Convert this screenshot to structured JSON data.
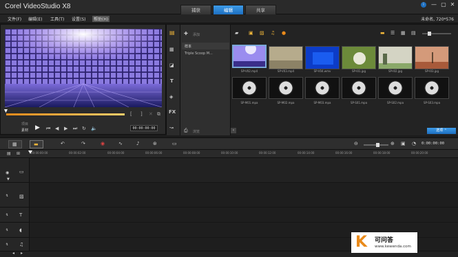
{
  "app": {
    "title": "Corel VideoStudio X8"
  },
  "tabs": [
    {
      "label": "捕获",
      "active": false
    },
    {
      "label": "编辑",
      "active": true
    },
    {
      "label": "共享",
      "active": false
    }
  ],
  "window_controls": {
    "info": "i",
    "minimize": "—",
    "restore": "▢",
    "close": "✕"
  },
  "menu": {
    "items": [
      {
        "label": "文件(F)"
      },
      {
        "label": "编辑(E)"
      },
      {
        "label": "工具(T)"
      },
      {
        "label": "设置(S)"
      },
      {
        "label": "帮助(H)",
        "active": true
      }
    ],
    "project_info": "未命名, 720*576"
  },
  "player": {
    "mode_project": "项目",
    "mode_clip": "素材",
    "timecode": "00:00:00:00"
  },
  "library": {
    "add_label": "添加",
    "browse_label": "浏览",
    "folders": [
      "样本",
      "Triple Scoop M..."
    ],
    "category_icons": [
      "media-icon",
      "instant-project-icon",
      "transition-icon",
      "title-icon",
      "graphic-icon",
      "filter-icon",
      "path-icon"
    ],
    "fx_label": "FX",
    "options_label": "选项",
    "thumbnails": [
      {
        "label": "SP-V02.mp4",
        "kind": "video",
        "selected": true
      },
      {
        "label": "SP-V03.mp4",
        "kind": "video"
      },
      {
        "label": "SP-V04.wmv",
        "kind": "video"
      },
      {
        "label": "SP-I01.jpg",
        "kind": "image"
      },
      {
        "label": "SP-I02.jpg",
        "kind": "image"
      },
      {
        "label": "SP-I03.jpg",
        "kind": "image"
      },
      {
        "label": "SP-M01.mpa",
        "kind": "audio"
      },
      {
        "label": "SP-M02.mpa",
        "kind": "audio"
      },
      {
        "label": "SP-M03.mpa",
        "kind": "audio"
      },
      {
        "label": "SP-S01.mpa",
        "kind": "audio"
      },
      {
        "label": "SP-S02.mpa",
        "kind": "audio"
      },
      {
        "label": "SP-S03.mpa",
        "kind": "audio"
      }
    ]
  },
  "timeline": {
    "timecode": "0:00:00:00",
    "ruler": [
      "00:00:00:00",
      "00:00:02:00",
      "00:00:04:00",
      "00:00:06:00",
      "00:00:08:00",
      "00:00:10:00",
      "00:00:12:00",
      "00:00:14:00",
      "00:00:16:00",
      "00:00:18:00",
      "00:00:20:00"
    ]
  },
  "watermark": {
    "letter": "K",
    "cn": "可问答",
    "url": "www.kewenda.com"
  },
  "colors": {
    "accent": "#1d6fc0",
    "background": "#1c1c1c",
    "highlight": "#e98a1a"
  }
}
